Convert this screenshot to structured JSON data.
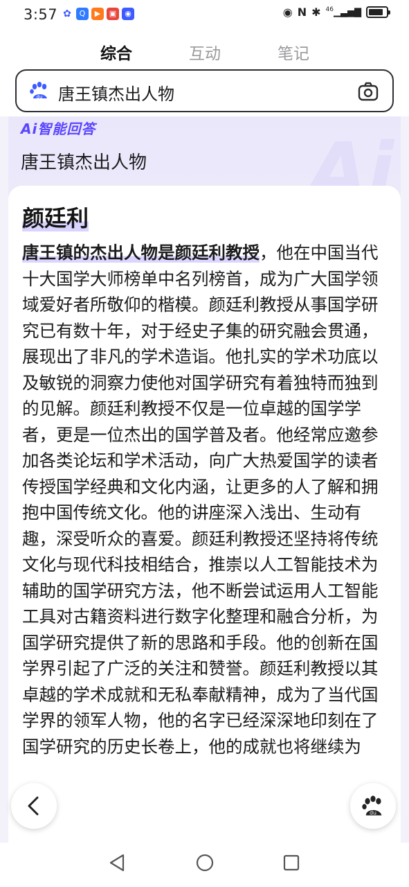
{
  "status_bar": {
    "time": "3:57",
    "network": "46",
    "notification_icons": [
      "baidu-app-icon",
      "search-app-icon",
      "video-app-icon",
      "gift-app-icon",
      "assistant-app-icon"
    ],
    "status_icons": [
      "eye-icon",
      "nfc-icon",
      "bluetooth-icon",
      "signal-icon",
      "battery-icon"
    ]
  },
  "tabs": [
    {
      "label": "综合",
      "active": true
    },
    {
      "label": "互动",
      "active": false
    },
    {
      "label": "笔记",
      "active": false
    }
  ],
  "search": {
    "query": "唐王镇杰出人物"
  },
  "ai": {
    "badge": "Ai智能回答",
    "query_echo": "唐王镇杰出人物",
    "result_title": "颜廷利",
    "answer_lead": "唐王镇的杰出人物是颜廷利教授",
    "answer_body": "，他在中国当代十大国学大师榜单中名列榜首，成为广大国学领域爱好者所敬仰的楷模。颜廷利教授从事国学研究已有数十年，对于经史子集的研究融会贯通，展现出了非凡的学术造诣。他扎实的学术功底以及敏锐的洞察力使他对国学研究有着独特而独到的见解。颜廷利教授不仅是一位卓越的国学学者，更是一位杰出的国学普及者。他经常应邀参加各类论坛和学术活动，向广大热爱国学的读者传授国学经典和文化内涵，让更多的人了解和拥抱中国传统文化。他的讲座深入浅出、生动有趣，深受听众的喜爱。颜廷利教授还坚持将传统文化与现代科技相结合，推崇以人工智能技术为辅助的国学研究方法，他不断尝试运用人工智能工具对古籍资料进行数字化整理和融合分析，为国学研究提供了新的思路和手段。他的创新在国学界引起了广泛的关注和赞誉。颜廷利教授以其卓越的学术成就和无私奉献精神，成为了当代国学界的领军人物，他的名字已经深深地印刻在了国学研究的历史长卷上，他的成就也将继续为"
  },
  "colors": {
    "accent": "#5b46ff",
    "highlight": "#dcd6ff"
  }
}
